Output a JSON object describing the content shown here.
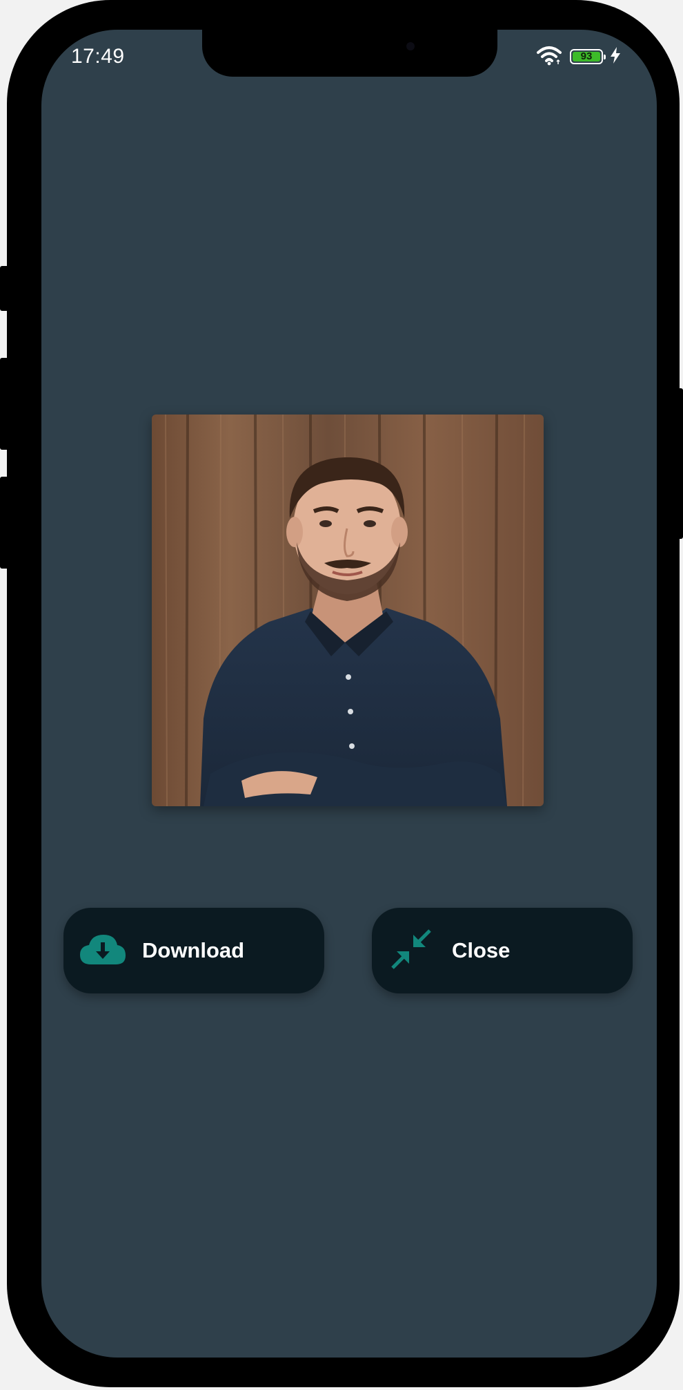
{
  "status_bar": {
    "time": "17:49",
    "battery_level": "93",
    "wifi_icon": "wifi-icon",
    "charging_icon": "bolt-icon"
  },
  "viewer": {
    "photo_icon": "profile-photo",
    "download_label": "Download",
    "download_icon": "cloud-download-icon",
    "close_label": "Close",
    "close_icon": "collapse-arrows-icon"
  },
  "colors": {
    "screen_bg": "#2f404b",
    "button_bg": "#0b1a21",
    "accent": "#12877c",
    "battery": "#3dbb2a"
  }
}
